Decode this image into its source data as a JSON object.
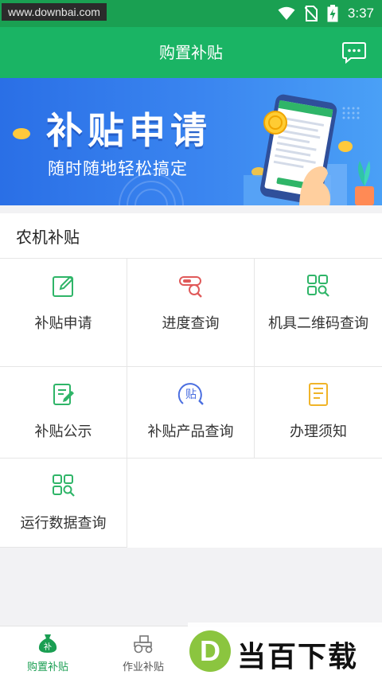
{
  "status_bar": {
    "watermark": "www.downbai.com",
    "time": "3:37"
  },
  "header": {
    "title": "购置补贴",
    "message_icon": "chat-bubble-icon"
  },
  "banner": {
    "title": "补贴申请",
    "subtitle": "随时随地轻松搞定"
  },
  "section": {
    "title": "农机补贴",
    "items": [
      {
        "label": "补贴申请",
        "icon": "edit-icon",
        "color": "#2fb568"
      },
      {
        "label": "进度查询",
        "icon": "progress-search-icon",
        "color": "#e05a5a"
      },
      {
        "label": "机具二维码查询",
        "icon": "qrcode-search-icon",
        "color": "#2fb568"
      },
      {
        "label": "补贴公示",
        "icon": "notice-edit-icon",
        "color": "#2fb568"
      },
      {
        "label": "补贴产品查询",
        "icon": "subsidy-search-icon",
        "color": "#4a6ee0",
        "icon_text": "贴"
      },
      {
        "label": "办理须知",
        "icon": "document-icon",
        "color": "#f0b429"
      },
      {
        "label": "运行数据查询",
        "icon": "data-search-icon",
        "color": "#2fb568"
      }
    ]
  },
  "tabs": [
    {
      "label": "购置补贴",
      "icon": "money-bag-icon",
      "active": true
    },
    {
      "label": "作业补贴",
      "icon": "tractor-icon",
      "active": false
    },
    {
      "label": "",
      "icon": "tab-3-icon",
      "active": false
    },
    {
      "label": "",
      "icon": "tab-4-icon",
      "active": false
    }
  ],
  "watermark_logo": {
    "letter": "D",
    "text": "当百下载"
  },
  "colors": {
    "status_bar": "#1aa052",
    "header": "#1ab464",
    "active_tab": "#1a9e52",
    "inactive_tab": "#666666"
  }
}
